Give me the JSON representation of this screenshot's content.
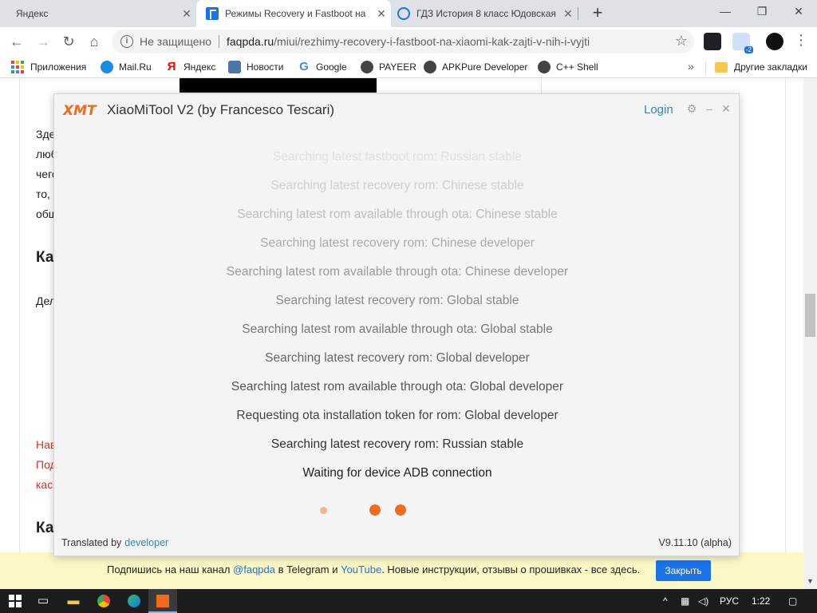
{
  "browser": {
    "tabs": [
      {
        "title": "Яндекс",
        "active": false
      },
      {
        "title": "Режимы Recovery и Fastboot на",
        "active": true
      },
      {
        "title": "ГДЗ История 8 класс Юдовская",
        "active": false
      }
    ],
    "address": {
      "security": "Не защищено",
      "host": "faqpda.ru",
      "path": "/miui/rezhimy-recovery-i-fastboot-na-xiaomi-kak-zajti-v-nih-i-vyjti"
    },
    "extension_badge": "-2",
    "bookmarks": [
      {
        "label": "Приложения",
        "icon": "apps-grid-icon"
      },
      {
        "label": "Mail.Ru",
        "icon": "mailru-icon",
        "color": "#168de2"
      },
      {
        "label": "Яндекс",
        "icon": "yandex-icon",
        "color": "#ff0000"
      },
      {
        "label": "Новости",
        "icon": "vk-icon",
        "color": "#4a76a8"
      },
      {
        "label": "Google",
        "icon": "google-icon",
        "color": "#4285f4"
      },
      {
        "label": "PAYEER",
        "icon": "payeer-icon",
        "color": "#444444"
      },
      {
        "label": "APKPure Developer",
        "icon": "apkpure-icon",
        "color": "#444444"
      },
      {
        "label": "C++ Shell",
        "icon": "cppshell-icon",
        "color": "#444444"
      }
    ],
    "other_bookmarks": "Другие закладки"
  },
  "page": {
    "fragments": [
      {
        "text": "Зде",
        "style": "normal"
      },
      {
        "text": "люб",
        "style": "normal"
      },
      {
        "text": "чего",
        "style": "normal"
      },
      {
        "text": "то, ",
        "style": "normal"
      },
      {
        "text": "общ",
        "style": "normal"
      },
      {
        "text": "Ка",
        "style": "head"
      },
      {
        "text": "Дел",
        "style": "normal"
      },
      {
        "text": "Нав",
        "style": "red"
      },
      {
        "text": "Под",
        "style": "red"
      },
      {
        "text": "кас",
        "style": "red"
      },
      {
        "text": "Ка",
        "style": "head"
      }
    ],
    "banner": {
      "text_before": "Подпишись на наш канал ",
      "channel": "@faqpda",
      "text_mid": " в Telegram и ",
      "youtube": "YouTube",
      "text_after": ". Новые инструкции, отзывы о прошивках - все здесь.",
      "button": "Закрыть"
    }
  },
  "app": {
    "logo": "XMT",
    "title": "XiaoMiTool V2 (by Francesco Tescari)",
    "login": "Login",
    "log_lines": [
      "Searching latest fastboot rom: Russian stable",
      "Searching latest recovery rom: Chinese stable",
      "Searching latest rom available through ota: Chinese stable",
      "Searching latest recovery rom: Chinese developer",
      "Searching latest rom available through ota: Chinese developer",
      "Searching latest recovery rom: Global stable",
      "Searching latest rom available through ota: Global stable",
      "Searching latest recovery rom: Global developer",
      "Searching latest rom available through ota: Global developer",
      "Requesting ota installation token for rom: Global developer",
      "Searching latest recovery rom: Russian stable",
      "Waiting for device ADB connection"
    ],
    "footer_prefix": "Translated by",
    "footer_link": "developer",
    "version": "V9.11.10 (alpha)",
    "accent": "#f26a1b"
  },
  "taskbar": {
    "lang": "РУС",
    "time": "1:22"
  }
}
